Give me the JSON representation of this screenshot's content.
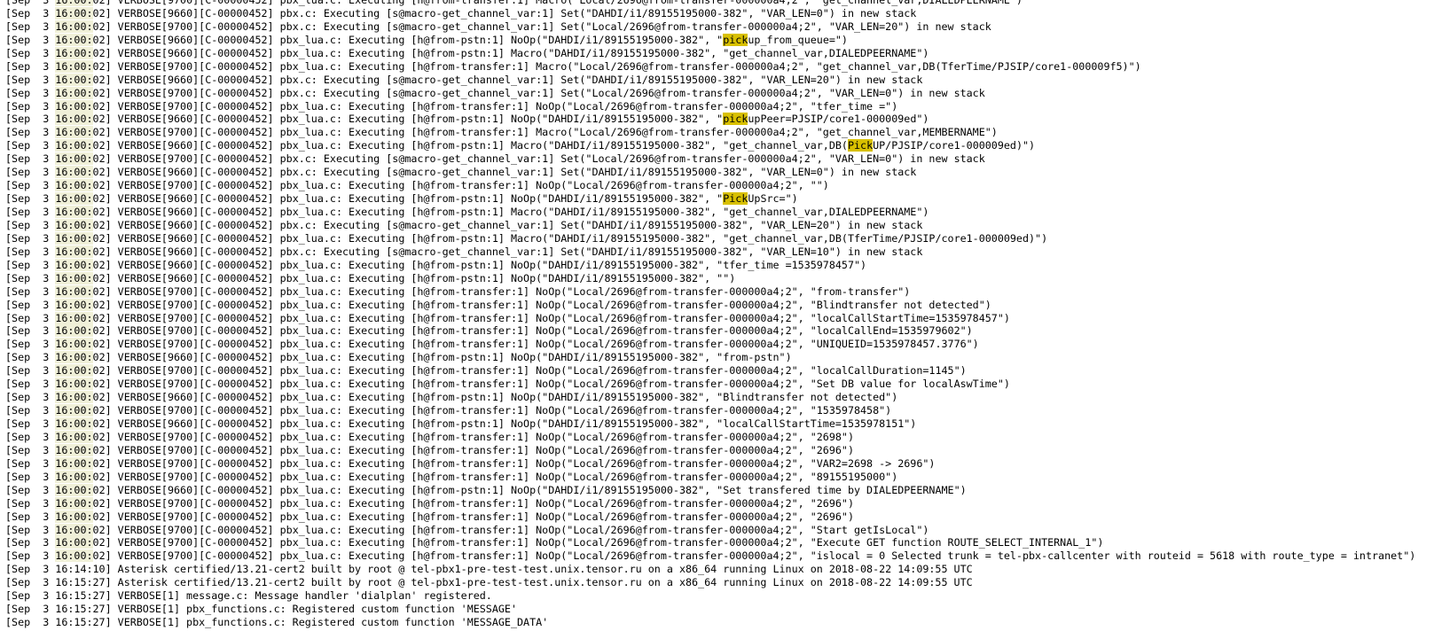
{
  "terminal": {
    "highlight_colors": {
      "time_marker": "#f0f0d8",
      "search_match": "#d8c000"
    },
    "lines": [
      [
        {
          "t": "[Sep  3 "
        },
        {
          "t": "16:00:",
          "h": "hl"
        },
        {
          "t": "02] VERBOSE[9700][C-00000452] pbx_lua.c: Executing [h@from-transfer:1] Macro(\"Local/2696@from-transfer-000000a4;2\", \"get_channel_var,DIALEDPEERNAME\")"
        }
      ],
      [
        {
          "t": "[Sep  3 "
        },
        {
          "t": "16:00:",
          "h": "hl"
        },
        {
          "t": "02] VERBOSE[9660][C-00000452] pbx.c: Executing [s@macro-get_channel_var:1] Set(\"DAHDI/i1/89155195000-382\", \"VAR_LEN=0\") in new stack"
        }
      ],
      [
        {
          "t": "[Sep  3 "
        },
        {
          "t": "16:00:",
          "h": "hl"
        },
        {
          "t": "02] VERBOSE[9700][C-00000452] pbx.c: Executing [s@macro-get_channel_var:1] Set(\"Local/2696@from-transfer-000000a4;2\", \"VAR_LEN=20\") in new stack"
        }
      ],
      [
        {
          "t": "[Sep  3 "
        },
        {
          "t": "16:00:",
          "h": "hl"
        },
        {
          "t": "02] VERBOSE[9660][C-00000452] pbx_lua.c: Executing [h@from-pstn:1] NoOp(\"DAHDI/i1/89155195000-382\", \""
        },
        {
          "t": "pick",
          "h": "match"
        },
        {
          "t": "up_from_queue=\")"
        }
      ],
      [
        {
          "t": "[Sep  3 "
        },
        {
          "t": "16:00:",
          "h": "hl"
        },
        {
          "t": "02] VERBOSE[9660][C-00000452] pbx_lua.c: Executing [h@from-pstn:1] Macro(\"DAHDI/i1/89155195000-382\", \"get_channel_var,DIALEDPEERNAME\")"
        }
      ],
      [
        {
          "t": "[Sep  3 "
        },
        {
          "t": "16:00:",
          "h": "hl"
        },
        {
          "t": "02] VERBOSE[9700][C-00000452] pbx_lua.c: Executing [h@from-transfer:1] Macro(\"Local/2696@from-transfer-000000a4;2\", \"get_channel_var,DB(TferTime/PJSIP/core1-000009f5)\")"
        }
      ],
      [
        {
          "t": "[Sep  3 "
        },
        {
          "t": "16:00:",
          "h": "hl"
        },
        {
          "t": "02] VERBOSE[9660][C-00000452] pbx.c: Executing [s@macro-get_channel_var:1] Set(\"DAHDI/i1/89155195000-382\", \"VAR_LEN=20\") in new stack"
        }
      ],
      [
        {
          "t": "[Sep  3 "
        },
        {
          "t": "16:00:",
          "h": "hl"
        },
        {
          "t": "02] VERBOSE[9700][C-00000452] pbx.c: Executing [s@macro-get_channel_var:1] Set(\"Local/2696@from-transfer-000000a4;2\", \"VAR_LEN=0\") in new stack"
        }
      ],
      [
        {
          "t": "[Sep  3 "
        },
        {
          "t": "16:00:",
          "h": "hl"
        },
        {
          "t": "02] VERBOSE[9700][C-00000452] pbx_lua.c: Executing [h@from-transfer:1] NoOp(\"Local/2696@from-transfer-000000a4;2\", \"tfer_time =\")"
        }
      ],
      [
        {
          "t": "[Sep  3 "
        },
        {
          "t": "16:00:",
          "h": "hl"
        },
        {
          "t": "02] VERBOSE[9660][C-00000452] pbx_lua.c: Executing [h@from-pstn:1] NoOp(\"DAHDI/i1/89155195000-382\", \""
        },
        {
          "t": "pick",
          "h": "match"
        },
        {
          "t": "upPeer=PJSIP/core1-000009ed\")"
        }
      ],
      [
        {
          "t": "[Sep  3 "
        },
        {
          "t": "16:00:",
          "h": "hl"
        },
        {
          "t": "02] VERBOSE[9700][C-00000452] pbx_lua.c: Executing [h@from-transfer:1] Macro(\"Local/2696@from-transfer-000000a4;2\", \"get_channel_var,MEMBERNAME\")"
        }
      ],
      [
        {
          "t": "[Sep  3 "
        },
        {
          "t": "16:00:",
          "h": "hl"
        },
        {
          "t": "02] VERBOSE[9660][C-00000452] pbx_lua.c: Executing [h@from-pstn:1] Macro(\"DAHDI/i1/89155195000-382\", \"get_channel_var,DB("
        },
        {
          "t": "Pick",
          "h": "match"
        },
        {
          "t": "UP/PJSIP/core1-000009ed)\")"
        }
      ],
      [
        {
          "t": "[Sep  3 "
        },
        {
          "t": "16:00:",
          "h": "hl"
        },
        {
          "t": "02] VERBOSE[9700][C-00000452] pbx.c: Executing [s@macro-get_channel_var:1] Set(\"Local/2696@from-transfer-000000a4;2\", \"VAR_LEN=0\") in new stack"
        }
      ],
      [
        {
          "t": "[Sep  3 "
        },
        {
          "t": "16:00:",
          "h": "hl"
        },
        {
          "t": "02] VERBOSE[9660][C-00000452] pbx.c: Executing [s@macro-get_channel_var:1] Set(\"DAHDI/i1/89155195000-382\", \"VAR_LEN=0\") in new stack"
        }
      ],
      [
        {
          "t": "[Sep  3 "
        },
        {
          "t": "16:00:",
          "h": "hl"
        },
        {
          "t": "02] VERBOSE[9700][C-00000452] pbx_lua.c: Executing [h@from-transfer:1] NoOp(\"Local/2696@from-transfer-000000a4;2\", \"\")"
        }
      ],
      [
        {
          "t": "[Sep  3 "
        },
        {
          "t": "16:00:",
          "h": "hl"
        },
        {
          "t": "02] VERBOSE[9660][C-00000452] pbx_lua.c: Executing [h@from-pstn:1] NoOp(\"DAHDI/i1/89155195000-382\", \""
        },
        {
          "t": "Pick",
          "h": "match"
        },
        {
          "t": "UpSrc=\")"
        }
      ],
      [
        {
          "t": "[Sep  3 "
        },
        {
          "t": "16:00:",
          "h": "hl"
        },
        {
          "t": "02] VERBOSE[9660][C-00000452] pbx_lua.c: Executing [h@from-pstn:1] Macro(\"DAHDI/i1/89155195000-382\", \"get_channel_var,DIALEDPEERNAME\")"
        }
      ],
      [
        {
          "t": "[Sep  3 "
        },
        {
          "t": "16:00:",
          "h": "hl"
        },
        {
          "t": "02] VERBOSE[9660][C-00000452] pbx.c: Executing [s@macro-get_channel_var:1] Set(\"DAHDI/i1/89155195000-382\", \"VAR_LEN=20\") in new stack"
        }
      ],
      [
        {
          "t": "[Sep  3 "
        },
        {
          "t": "16:00:",
          "h": "hl"
        },
        {
          "t": "02] VERBOSE[9660][C-00000452] pbx_lua.c: Executing [h@from-pstn:1] Macro(\"DAHDI/i1/89155195000-382\", \"get_channel_var,DB(TferTime/PJSIP/core1-000009ed)\")"
        }
      ],
      [
        {
          "t": "[Sep  3 "
        },
        {
          "t": "16:00:",
          "h": "hl"
        },
        {
          "t": "02] VERBOSE[9660][C-00000452] pbx.c: Executing [s@macro-get_channel_var:1] Set(\"DAHDI/i1/89155195000-382\", \"VAR_LEN=10\") in new stack"
        }
      ],
      [
        {
          "t": "[Sep  3 "
        },
        {
          "t": "16:00:",
          "h": "hl"
        },
        {
          "t": "02] VERBOSE[9660][C-00000452] pbx_lua.c: Executing [h@from-pstn:1] NoOp(\"DAHDI/i1/89155195000-382\", \"tfer_time =1535978457\")"
        }
      ],
      [
        {
          "t": "[Sep  3 "
        },
        {
          "t": "16:00:",
          "h": "hl"
        },
        {
          "t": "02] VERBOSE[9660][C-00000452] pbx_lua.c: Executing [h@from-pstn:1] NoOp(\"DAHDI/i1/89155195000-382\", \"\")"
        }
      ],
      [
        {
          "t": "[Sep  3 "
        },
        {
          "t": "16:00:",
          "h": "hl"
        },
        {
          "t": "02] VERBOSE[9700][C-00000452] pbx_lua.c: Executing [h@from-transfer:1] NoOp(\"Local/2696@from-transfer-000000a4;2\", \"from-transfer\")"
        }
      ],
      [
        {
          "t": "[Sep  3 "
        },
        {
          "t": "16:00:",
          "h": "hl"
        },
        {
          "t": "02] VERBOSE[9700][C-00000452] pbx_lua.c: Executing [h@from-transfer:1] NoOp(\"Local/2696@from-transfer-000000a4;2\", \"Blindtransfer not detected\")"
        }
      ],
      [
        {
          "t": "[Sep  3 "
        },
        {
          "t": "16:00:",
          "h": "hl"
        },
        {
          "t": "02] VERBOSE[9700][C-00000452] pbx_lua.c: Executing [h@from-transfer:1] NoOp(\"Local/2696@from-transfer-000000a4;2\", \"localCallStartTime=1535978457\")"
        }
      ],
      [
        {
          "t": "[Sep  3 "
        },
        {
          "t": "16:00:",
          "h": "hl"
        },
        {
          "t": "02] VERBOSE[9700][C-00000452] pbx_lua.c: Executing [h@from-transfer:1] NoOp(\"Local/2696@from-transfer-000000a4;2\", \"localCallEnd=1535979602\")"
        }
      ],
      [
        {
          "t": "[Sep  3 "
        },
        {
          "t": "16:00:",
          "h": "hl"
        },
        {
          "t": "02] VERBOSE[9700][C-00000452] pbx_lua.c: Executing [h@from-transfer:1] NoOp(\"Local/2696@from-transfer-000000a4;2\", \"UNIQUEID=1535978457.3776\")"
        }
      ],
      [
        {
          "t": "[Sep  3 "
        },
        {
          "t": "16:00:",
          "h": "hl"
        },
        {
          "t": "02] VERBOSE[9660][C-00000452] pbx_lua.c: Executing [h@from-pstn:1] NoOp(\"DAHDI/i1/89155195000-382\", \"from-pstn\")"
        }
      ],
      [
        {
          "t": "[Sep  3 "
        },
        {
          "t": "16:00:",
          "h": "hl"
        },
        {
          "t": "02] VERBOSE[9700][C-00000452] pbx_lua.c: Executing [h@from-transfer:1] NoOp(\"Local/2696@from-transfer-000000a4;2\", \"localCallDuration=1145\")"
        }
      ],
      [
        {
          "t": "[Sep  3 "
        },
        {
          "t": "16:00:",
          "h": "hl"
        },
        {
          "t": "02] VERBOSE[9700][C-00000452] pbx_lua.c: Executing [h@from-transfer:1] NoOp(\"Local/2696@from-transfer-000000a4;2\", \"Set DB value for localAswTime\")"
        }
      ],
      [
        {
          "t": "[Sep  3 "
        },
        {
          "t": "16:00:",
          "h": "hl"
        },
        {
          "t": "02] VERBOSE[9660][C-00000452] pbx_lua.c: Executing [h@from-pstn:1] NoOp(\"DAHDI/i1/89155195000-382\", \"Blindtransfer not detected\")"
        }
      ],
      [
        {
          "t": "[Sep  3 "
        },
        {
          "t": "16:00:",
          "h": "hl"
        },
        {
          "t": "02] VERBOSE[9700][C-00000452] pbx_lua.c: Executing [h@from-transfer:1] NoOp(\"Local/2696@from-transfer-000000a4;2\", \"1535978458\")"
        }
      ],
      [
        {
          "t": "[Sep  3 "
        },
        {
          "t": "16:00:",
          "h": "hl"
        },
        {
          "t": "02] VERBOSE[9660][C-00000452] pbx_lua.c: Executing [h@from-pstn:1] NoOp(\"DAHDI/i1/89155195000-382\", \"localCallStartTime=1535978151\")"
        }
      ],
      [
        {
          "t": "[Sep  3 "
        },
        {
          "t": "16:00:",
          "h": "hl"
        },
        {
          "t": "02] VERBOSE[9700][C-00000452] pbx_lua.c: Executing [h@from-transfer:1] NoOp(\"Local/2696@from-transfer-000000a4;2\", \"2698\")"
        }
      ],
      [
        {
          "t": "[Sep  3 "
        },
        {
          "t": "16:00:",
          "h": "hl"
        },
        {
          "t": "02] VERBOSE[9700][C-00000452] pbx_lua.c: Executing [h@from-transfer:1] NoOp(\"Local/2696@from-transfer-000000a4;2\", \"2696\")"
        }
      ],
      [
        {
          "t": "[Sep  3 "
        },
        {
          "t": "16:00:",
          "h": "hl"
        },
        {
          "t": "02] VERBOSE[9700][C-00000452] pbx_lua.c: Executing [h@from-transfer:1] NoOp(\"Local/2696@from-transfer-000000a4;2\", \"VAR2=2698 -> 2696\")"
        }
      ],
      [
        {
          "t": "[Sep  3 "
        },
        {
          "t": "16:00:",
          "h": "hl"
        },
        {
          "t": "02] VERBOSE[9700][C-00000452] pbx_lua.c: Executing [h@from-transfer:1] NoOp(\"Local/2696@from-transfer-000000a4;2\", \"89155195000\")"
        }
      ],
      [
        {
          "t": "[Sep  3 "
        },
        {
          "t": "16:00:",
          "h": "hl"
        },
        {
          "t": "02] VERBOSE[9660][C-00000452] pbx_lua.c: Executing [h@from-pstn:1] NoOp(\"DAHDI/i1/89155195000-382\", \"Set transfered time by DIALEDPEERNAME\")"
        }
      ],
      [
        {
          "t": "[Sep  3 "
        },
        {
          "t": "16:00:",
          "h": "hl"
        },
        {
          "t": "02] VERBOSE[9700][C-00000452] pbx_lua.c: Executing [h@from-transfer:1] NoOp(\"Local/2696@from-transfer-000000a4;2\", \"2696\")"
        }
      ],
      [
        {
          "t": "[Sep  3 "
        },
        {
          "t": "16:00:",
          "h": "hl"
        },
        {
          "t": "02] VERBOSE[9700][C-00000452] pbx_lua.c: Executing [h@from-transfer:1] NoOp(\"Local/2696@from-transfer-000000a4;2\", \"2696\")"
        }
      ],
      [
        {
          "t": "[Sep  3 "
        },
        {
          "t": "16:00:",
          "h": "hl"
        },
        {
          "t": "02] VERBOSE[9700][C-00000452] pbx_lua.c: Executing [h@from-transfer:1] NoOp(\"Local/2696@from-transfer-000000a4;2\", \"Start getIsLocal\")"
        }
      ],
      [
        {
          "t": "[Sep  3 "
        },
        {
          "t": "16:00:",
          "h": "hl"
        },
        {
          "t": "02] VERBOSE[9700][C-00000452] pbx_lua.c: Executing [h@from-transfer:1] NoOp(\"Local/2696@from-transfer-000000a4;2\", \"Execute GET function ROUTE_SELECT_INTERNAL_1\")"
        }
      ],
      [
        {
          "t": "[Sep  3 "
        },
        {
          "t": "16:00:",
          "h": "hl"
        },
        {
          "t": "02] VERBOSE[9700][C-00000452] pbx_lua.c: Executing [h@from-transfer:1] NoOp(\"Local/2696@from-transfer-000000a4;2\", \"islocal = 0 Selected trunk = tel-pbx-callcenter with routeid = 5618 with route_type = intranet\")"
        }
      ],
      [
        {
          "t": "[Sep  3 16:14:10] Asterisk certified/13.21-cert2 built by root @ tel-pbx1-pre-test-test.unix.tensor.ru on a x86_64 running Linux on 2018-08-22 14:09:55 UTC"
        }
      ],
      [
        {
          "t": "[Sep  3 16:15:27] Asterisk certified/13.21-cert2 built by root @ tel-pbx1-pre-test-test.unix.tensor.ru on a x86_64 running Linux on 2018-08-22 14:09:55 UTC"
        }
      ],
      [
        {
          "t": "[Sep  3 16:15:27] VERBOSE[1] message.c: Message handler 'dialplan' registered."
        }
      ],
      [
        {
          "t": "[Sep  3 16:15:27] VERBOSE[1] pbx_functions.c: Registered custom function 'MESSAGE'"
        }
      ],
      [
        {
          "t": "[Sep  3 16:15:27] VERBOSE[1] pbx_functions.c: Registered custom function 'MESSAGE_DATA'"
        }
      ]
    ]
  }
}
